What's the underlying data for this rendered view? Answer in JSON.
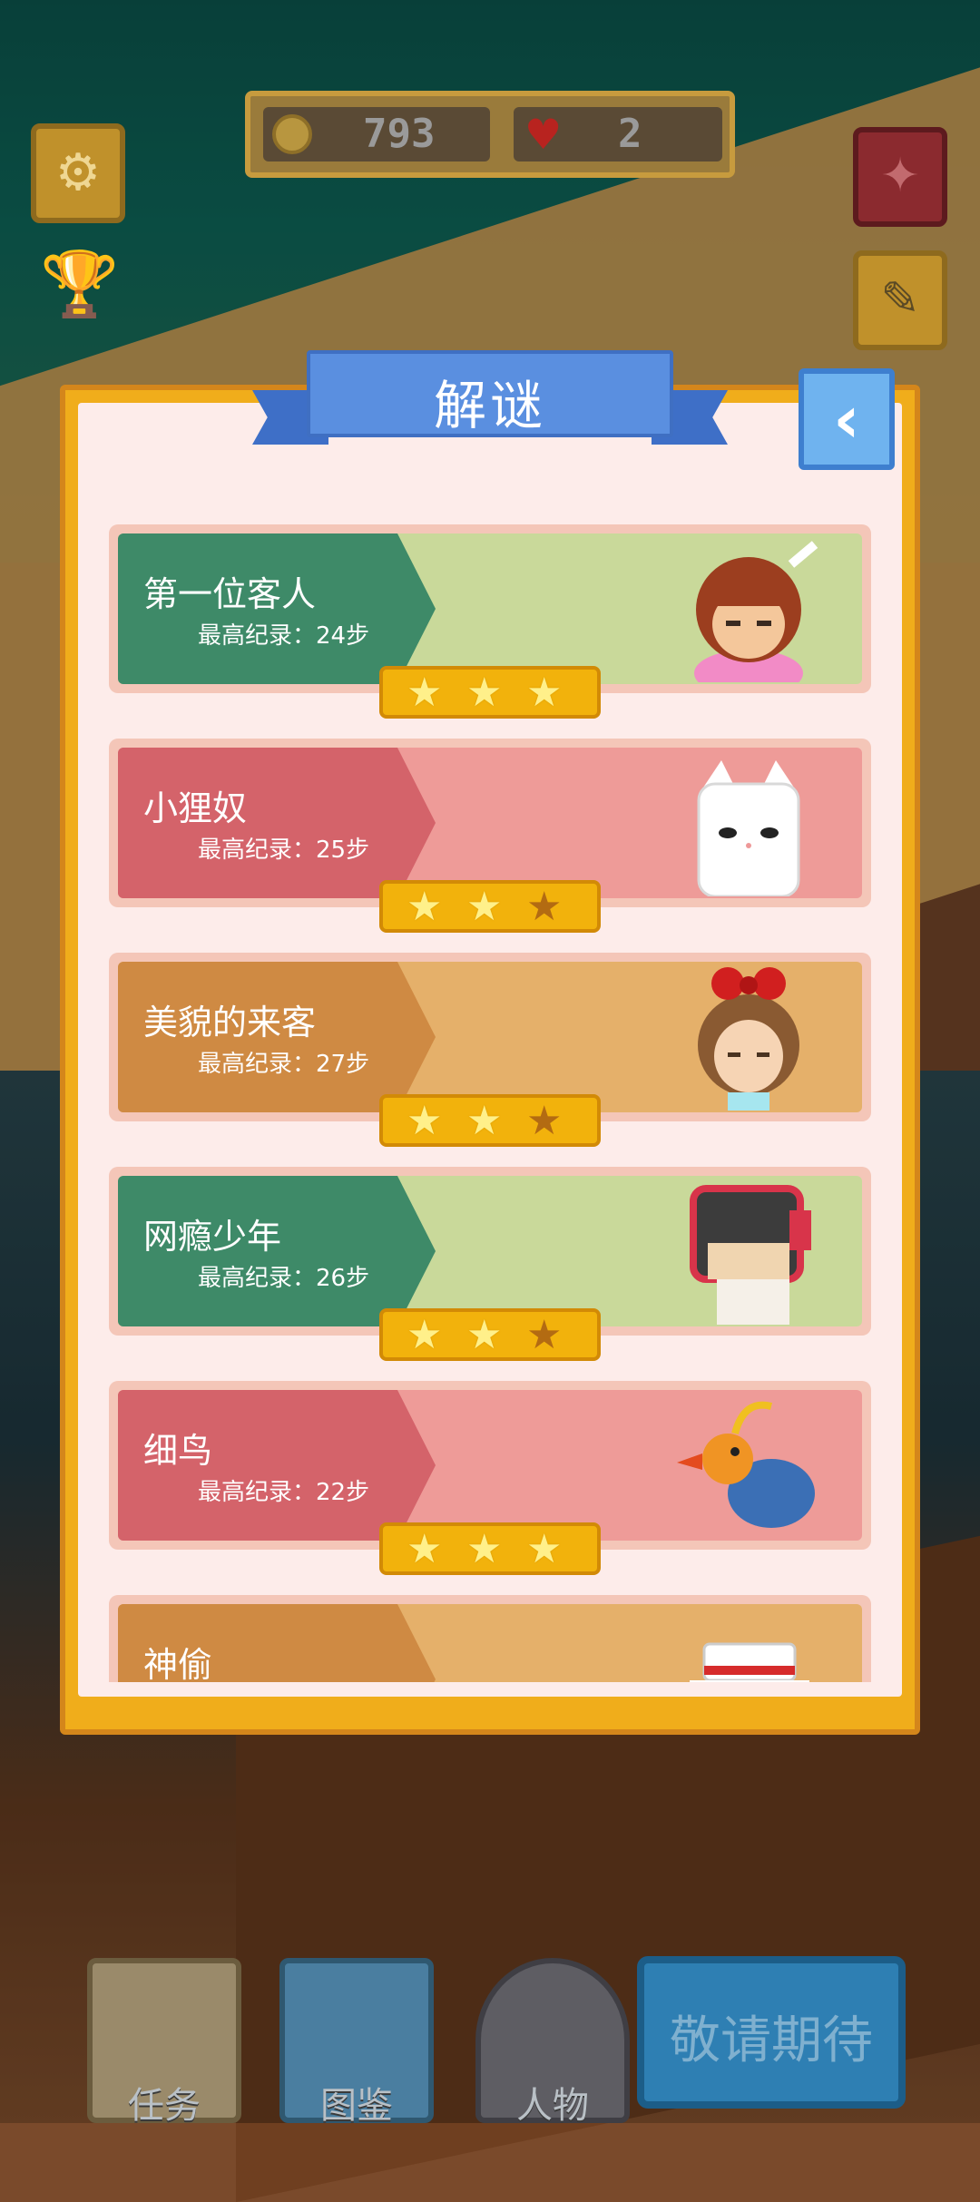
{
  "hud": {
    "coins": "793",
    "lives": "2"
  },
  "panel": {
    "title": "解谜"
  },
  "levels": [
    {
      "name": "第一位客人",
      "record": "最高纪录：24步",
      "stars": 3,
      "theme": "green"
    },
    {
      "name": "小狸奴",
      "record": "最高纪录：25步",
      "stars": 2,
      "theme": "red"
    },
    {
      "name": "美貌的来客",
      "record": "最高纪录：27步",
      "stars": 2,
      "theme": "gold"
    },
    {
      "name": "网瘾少年",
      "record": "最高纪录：26步",
      "stars": 2,
      "theme": "green"
    },
    {
      "name": "细鸟",
      "record": "最高纪录：22步",
      "stars": 3,
      "theme": "red"
    },
    {
      "name": "神偷",
      "record": "",
      "stars": null,
      "theme": "gold"
    }
  ],
  "nav": {
    "tasks": "任务",
    "codex": "图鉴",
    "characters": "人物",
    "coming_soon": "敬请期待"
  },
  "colors": {
    "panel_gold": "#f0ad1b",
    "ribbon_blue": "#5a8fe0",
    "star_gold": "#f2b20c"
  }
}
